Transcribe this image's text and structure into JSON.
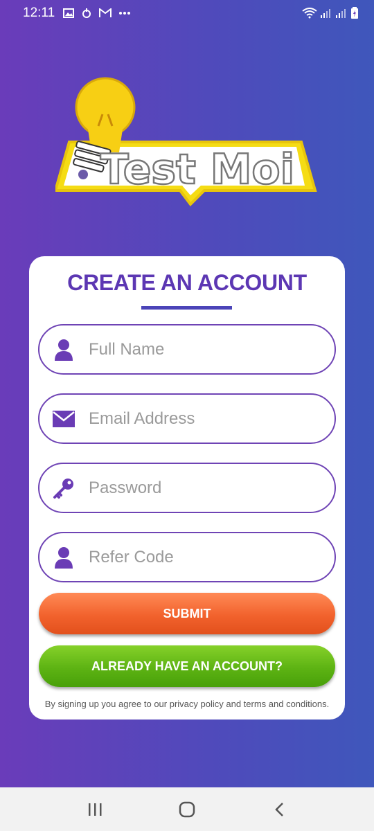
{
  "status_bar": {
    "time": "12:11",
    "left_icons": [
      "image-icon",
      "sync-icon",
      "gmail-icon",
      "more-icon"
    ],
    "right_icons": [
      "wifi-icon",
      "signal-icon",
      "signal-icon-2",
      "battery-icon"
    ]
  },
  "logo": {
    "text": "Test Moi"
  },
  "form": {
    "title": "CREATE AN ACCOUNT",
    "fields": [
      {
        "placeholder": "Full Name",
        "icon": "person-icon"
      },
      {
        "placeholder": "Email Address",
        "icon": "envelope-icon"
      },
      {
        "placeholder": "Password",
        "icon": "key-icon"
      },
      {
        "placeholder": "Refer Code",
        "icon": "person-icon"
      }
    ],
    "submit_label": "SUBMIT",
    "login_label": "ALREADY HAVE AN ACCOUNT?",
    "terms": "By signing up you agree to our privacy policy and terms and conditions."
  },
  "colors": {
    "accent": "#5c37b3",
    "submit": "#f2622d",
    "login": "#5db313"
  },
  "nav_bar": {
    "buttons": [
      "recents-icon",
      "home-icon",
      "back-icon"
    ]
  }
}
